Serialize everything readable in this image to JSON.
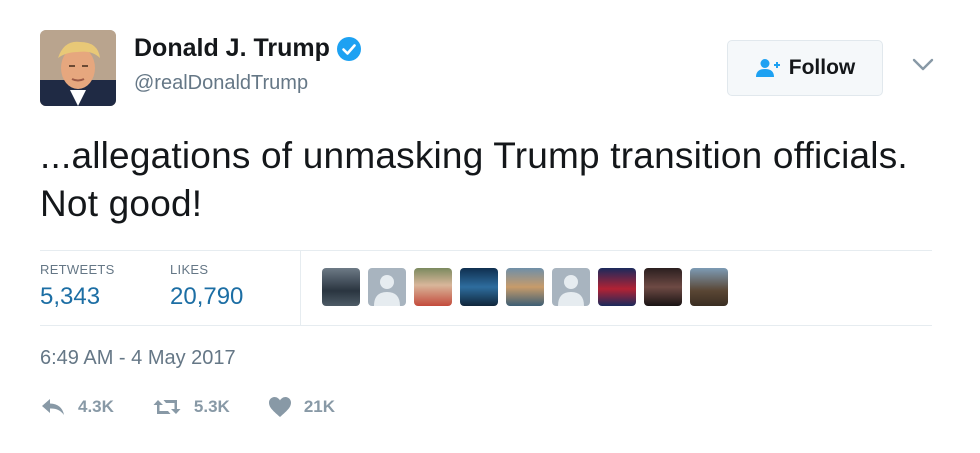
{
  "author": {
    "name": "Donald J. Trump",
    "handle": "@realDonaldTrump",
    "verified": true
  },
  "follow_button": {
    "label": "Follow"
  },
  "tweet": {
    "text": "...allegations of unmasking Trump transition officials. Not good!"
  },
  "stats": {
    "retweets_label": "RETWEETS",
    "retweets_value": "5,343",
    "likes_label": "LIKES",
    "likes_value": "20,790"
  },
  "likers_count": 9,
  "timestamp": "6:49 AM - 4 May 2017",
  "actions": {
    "reply_count": "4.3K",
    "retweet_count": "5.3K",
    "like_count": "21K"
  },
  "colors": {
    "accent": "#1da1f2",
    "stat_value": "#1c6ea4",
    "muted": "#657786",
    "action_icon": "#8899a6"
  }
}
